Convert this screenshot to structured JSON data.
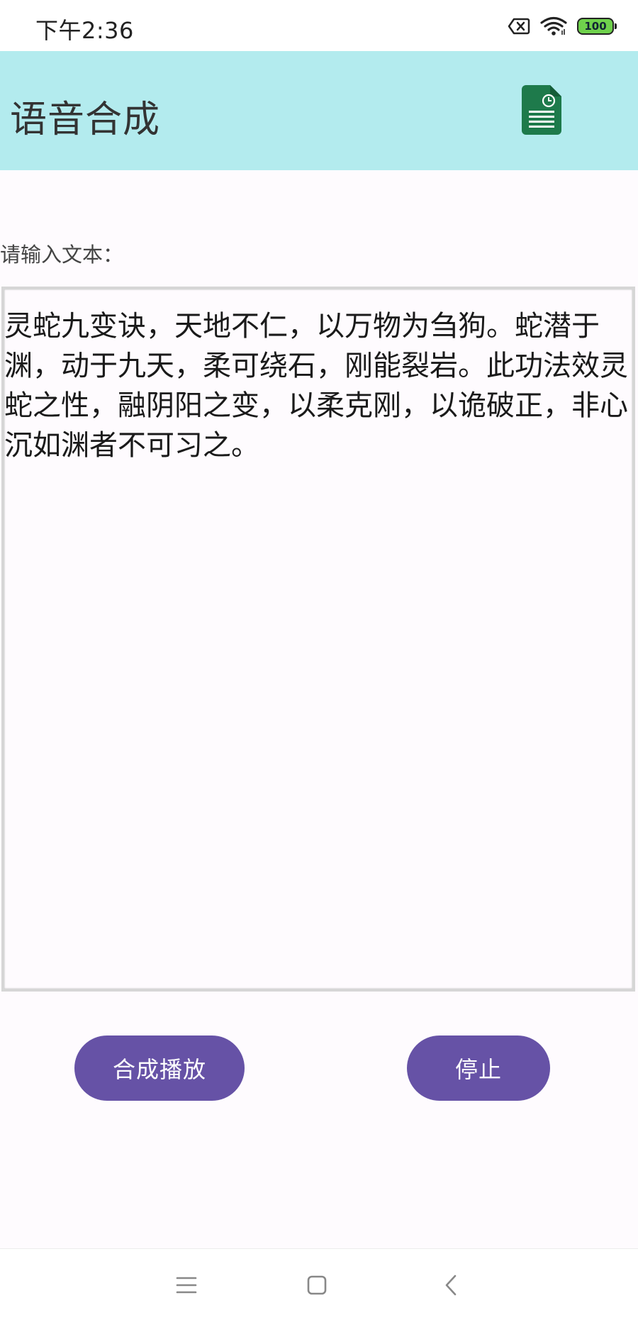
{
  "status_bar": {
    "time": "下午2:36",
    "battery_level": "100",
    "icons": [
      "sim-off-icon",
      "wifi-icon",
      "battery-icon"
    ]
  },
  "app_bar": {
    "title": "语音合成",
    "action_icon": "spreadsheet-icon"
  },
  "form": {
    "input_label": "请输入文本：",
    "text_value": "灵蛇九变诀，天地不仁，以万物为刍狗。蛇潜于渊，动于九天，柔可绕石，刚能裂岩。此功法效灵蛇之性，融阴阳之变，以柔克刚，以诡破正，非心沉如渊者不可习之。"
  },
  "buttons": {
    "play_label": "合成播放",
    "stop_label": "停止"
  },
  "nav_bar": {
    "icons": [
      "menu-icon",
      "home-icon",
      "back-icon"
    ]
  },
  "colors": {
    "app_bar_bg": "#b3ebee",
    "button_bg": "#6652a6",
    "battery_fill": "#6fd14c",
    "sheet_icon": "#1e7a4b"
  }
}
